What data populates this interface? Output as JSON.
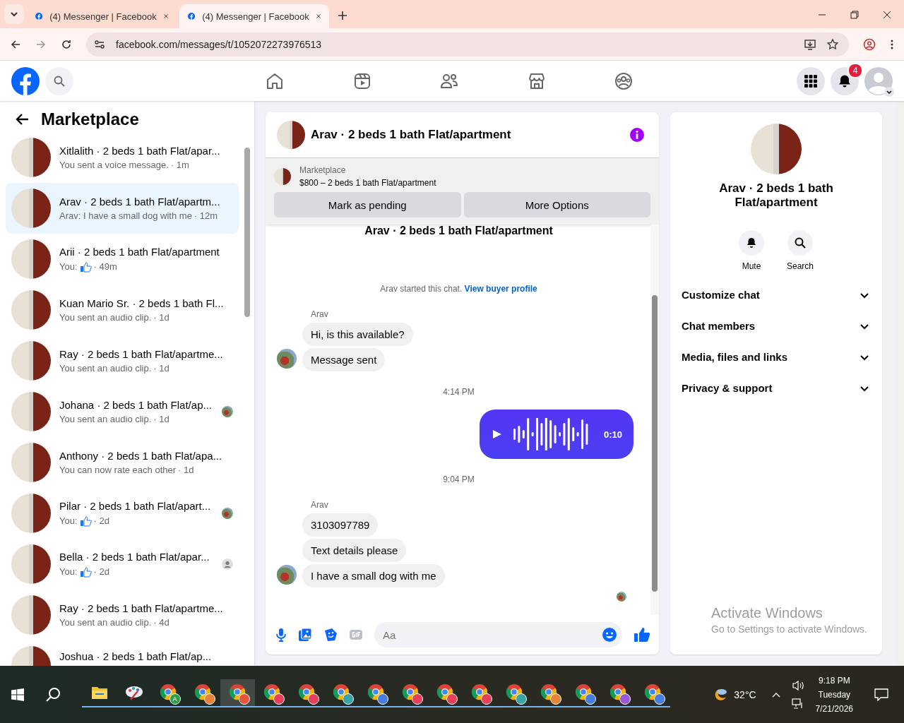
{
  "browser": {
    "tabs": [
      {
        "title": "(4) Messenger | Facebook",
        "selected": false
      },
      {
        "title": "(4) Messenger | Facebook",
        "selected": true
      }
    ],
    "url": "facebook.com/messages/t/1052072273976513"
  },
  "header": {
    "notification_count": "4"
  },
  "sidebar": {
    "title": "Marketplace",
    "conversations": [
      {
        "name": "Xitlalith · 2 beds 1 bath Flat/apar...",
        "preview": "You sent a voice message.",
        "meta": "· 1m",
        "selected": false
      },
      {
        "name": "Arav · 2 beds 1 bath Flat/apartm...",
        "preview": "Arav: I have a small dog with me",
        "meta": "· 12m",
        "selected": true
      },
      {
        "name": "Arii · 2 beds 1 bath Flat/apartment",
        "preview": "You:",
        "like": true,
        "meta": "· 49m",
        "selected": false
      },
      {
        "name": "Kuan Mario Sr. · 2 beds 1 bath Fl...",
        "preview": "You sent an audio clip.",
        "meta": "· 1d",
        "selected": false
      },
      {
        "name": "Ray · 2 beds 1 bath Flat/apartme...",
        "preview": "You sent an audio clip.",
        "meta": "· 1d",
        "selected": false
      },
      {
        "name": "Johana · 2 beds 1 bath Flat/ap...",
        "preview": "You sent an audio clip.",
        "meta": "· 1d",
        "selected": false,
        "receipt": {
          "kind": "photo"
        }
      },
      {
        "name": "Anthony · 2 beds 1 bath Flat/apa...",
        "preview": "You can now rate each other",
        "meta": "· 1d",
        "selected": false
      },
      {
        "name": "Pilar · 2 beds 1 bath Flat/apart...",
        "preview": "You:",
        "like": true,
        "meta": "· 2d",
        "selected": false,
        "receipt": {
          "kind": "photo"
        }
      },
      {
        "name": "Bella · 2 beds 1 bath Flat/apar...",
        "preview": "You:",
        "like": true,
        "meta": "· 2d",
        "selected": false,
        "receipt": {
          "kind": "generic"
        }
      },
      {
        "name": "Ray · 2 beds 1 bath Flat/apartme...",
        "preview": "You sent an audio clip.",
        "meta": "· 4d",
        "selected": false
      },
      {
        "name": "Joshua · 2 beds 1 bath Flat/ap...",
        "selected": false
      }
    ]
  },
  "chat": {
    "title": "Arav · 2 beds 1 bath Flat/apartment",
    "listing": {
      "label": "Marketplace",
      "summary": "$800 – 2 beds 1 bath Flat/apartment",
      "buttons": [
        "Mark as pending",
        "More Options"
      ]
    },
    "messages": [
      {
        "kind": "heading",
        "text": "Arav · 2 beds 1 bath Flat/apartment"
      },
      {
        "kind": "system",
        "text": "Arav started this chat.",
        "link": "View buyer profile"
      },
      {
        "kind": "group",
        "sender": "Arav",
        "bubbles": [
          "Hi, is this available?",
          "Message sent"
        ]
      },
      {
        "kind": "time",
        "text": "4:14 PM"
      },
      {
        "kind": "voice",
        "duration": "0:10"
      },
      {
        "kind": "time",
        "text": "9:04 PM"
      },
      {
        "kind": "group",
        "sender": "Arav",
        "bubbles": [
          "3103097789",
          "Text details please",
          "I have a small dog with me"
        ]
      }
    ],
    "composer": {
      "placeholder": "Aa"
    }
  },
  "details": {
    "name": "Arav · 2 beds 1 bath Flat/apartment",
    "actions": [
      {
        "kind": "mute",
        "label": "Mute"
      },
      {
        "kind": "search",
        "label": "Search"
      }
    ],
    "sections": [
      {
        "label": "Customize chat",
        "expanded": false
      },
      {
        "label": "Chat members",
        "expanded": false
      },
      {
        "label": "Media, files and links",
        "expanded": false
      },
      {
        "label": "Privacy & support",
        "expanded": false
      }
    ]
  },
  "os_notice": {
    "title": "Activate Windows",
    "subtitle": "Go to Settings to activate Windows."
  },
  "taskbar": {
    "apps": [
      {
        "kind": "explorer",
        "selected": false
      },
      {
        "kind": "paint",
        "selected": false
      },
      {
        "kind": "chrome",
        "color": "#2e9e48",
        "letter": "A",
        "selected": false
      },
      {
        "kind": "chrome",
        "color": "#e8833a",
        "selected": false
      },
      {
        "kind": "chrome",
        "color": "#e8533a",
        "selected": true
      },
      {
        "kind": "chrome",
        "color": "#e8405a",
        "selected": false
      },
      {
        "kind": "chrome",
        "color": "#e8405a",
        "selected": false
      },
      {
        "kind": "chrome",
        "color": "#3aa3a8",
        "selected": false
      },
      {
        "kind": "chrome",
        "color": "#4a7de0",
        "selected": false
      },
      {
        "kind": "chrome",
        "color": "#e8405a",
        "selected": false
      },
      {
        "kind": "chrome",
        "color": "#e8405a",
        "selected": false
      },
      {
        "kind": "chrome",
        "color": "#e8405a",
        "selected": false
      },
      {
        "kind": "chrome",
        "color": "#3aa3a8",
        "selected": false
      },
      {
        "kind": "chrome",
        "color": "#e8833a",
        "selected": false
      },
      {
        "kind": "chrome",
        "color": "#4a7de0",
        "selected": false
      },
      {
        "kind": "chrome",
        "color": "#9a5ad8",
        "selected": false
      },
      {
        "kind": "chrome",
        "color": "#4a7de0",
        "selected": false
      }
    ],
    "temperature": "32°C",
    "time": "9:18 PM",
    "day": "Tuesday",
    "date": "7/21/2026"
  }
}
